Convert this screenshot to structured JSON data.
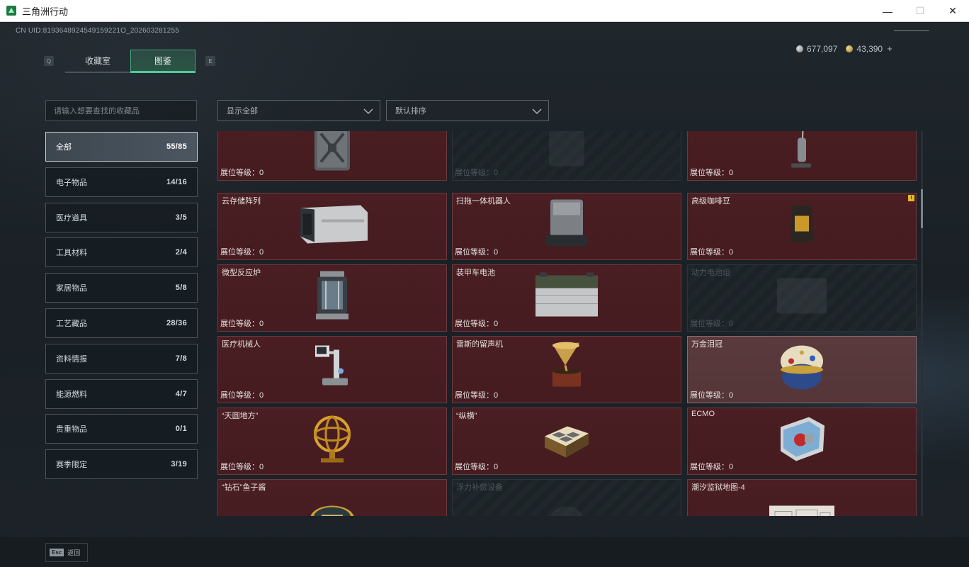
{
  "window": {
    "title": "三角洲行动",
    "minimize": "—",
    "maximize": "☐",
    "close": "✕"
  },
  "uid": "CN UID:8193648924549159221O_202603281255",
  "tabs": {
    "left_key": "Q",
    "right_key": "E",
    "items": [
      "收藏室",
      "图鉴"
    ],
    "active_index": 1
  },
  "currency": {
    "silver": "677,097",
    "gold": "43,390",
    "add": "+"
  },
  "search": {
    "placeholder": "请输入想要查找的收藏品"
  },
  "filters": {
    "display": "显示全部",
    "sort": "默认排序"
  },
  "categories": [
    {
      "label": "全部",
      "count": "55/85",
      "active": true
    },
    {
      "label": "电子物品",
      "count": "14/16"
    },
    {
      "label": "医疗道具",
      "count": "3/5"
    },
    {
      "label": "工具材料",
      "count": "2/4"
    },
    {
      "label": "家居物品",
      "count": "5/8"
    },
    {
      "label": "工艺藏品",
      "count": "28/36"
    },
    {
      "label": "资料情报",
      "count": "7/8"
    },
    {
      "label": "能源燃料",
      "count": "4/7"
    },
    {
      "label": "贵重物品",
      "count": "0/1"
    },
    {
      "label": "赛季限定",
      "count": "3/19"
    }
  ],
  "level_label": "展位等级：0",
  "items": [
    {
      "name": "",
      "icon": "jerrycan-icon",
      "state": "owned"
    },
    {
      "name": "",
      "icon": "machine-icon",
      "state": "locked"
    },
    {
      "name": "",
      "icon": "floor-washer-icon",
      "state": "owned"
    },
    {
      "name": "云存储阵列",
      "icon": "server-array-icon",
      "state": "owned"
    },
    {
      "name": "扫拖一体机器人",
      "icon": "robot-vacuum-dock-icon",
      "state": "owned"
    },
    {
      "name": "高级咖啡豆",
      "icon": "coffee-bag-icon",
      "state": "owned",
      "badge": "!"
    },
    {
      "name": "微型反应炉",
      "icon": "reactor-icon",
      "state": "owned"
    },
    {
      "name": "装甲车电池",
      "icon": "battery-icon",
      "state": "owned"
    },
    {
      "name": "动力电池组",
      "icon": "battery-pack-icon",
      "state": "locked"
    },
    {
      "name": "医疗机械人",
      "icon": "medical-robot-icon",
      "state": "owned"
    },
    {
      "name": "雷斯的留声机",
      "icon": "gramophone-icon",
      "state": "owned"
    },
    {
      "name": "万金泪冠",
      "icon": "jeweled-egg-icon",
      "state": "selected"
    },
    {
      "name": "“天圆地方”",
      "icon": "armillary-sphere-icon",
      "state": "owned"
    },
    {
      "name": "“纵横”",
      "icon": "chess-board-icon",
      "state": "owned"
    },
    {
      "name": "ECMO",
      "icon": "ecmo-machine-icon",
      "state": "owned"
    },
    {
      "name": "“钻石”鱼子酱",
      "icon": "caviar-tin-icon",
      "state": "owned"
    },
    {
      "name": "浮力补偿设备",
      "icon": "bcd-icon",
      "state": "locked"
    },
    {
      "name": "潮汐监狱地图-4",
      "icon": "map-icon",
      "state": "owned"
    }
  ],
  "back": {
    "key": "Esc",
    "label": "返回"
  },
  "colors": {
    "owned_card": "#4a1e22",
    "accent_green": "#53c99a",
    "badge_yellow": "#e2b72a"
  }
}
